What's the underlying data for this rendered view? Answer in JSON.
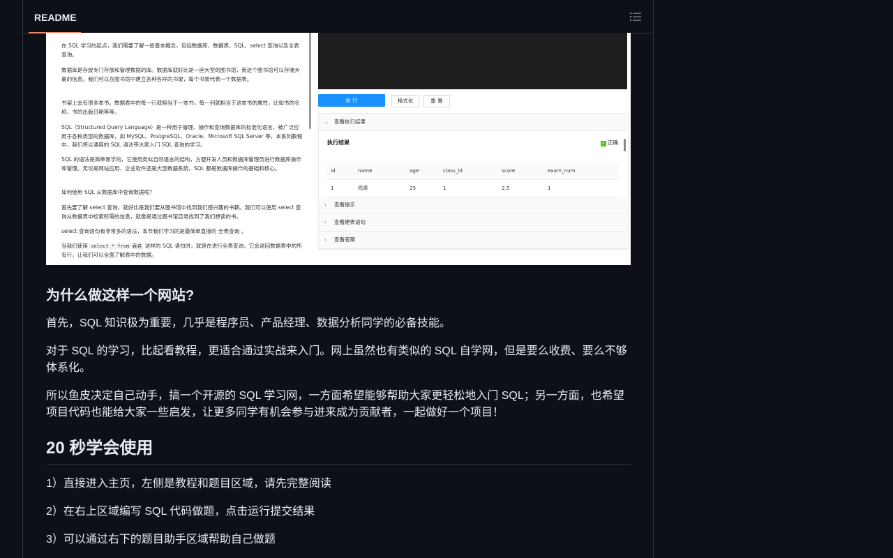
{
  "header": {
    "tab_label": "README",
    "outline_icon": "list-unordered-icon"
  },
  "screenshot": {
    "left_paragraphs": [
      "在 SQL 学习的起点，我们需要了解一些基本概念，包括数据库、数据表、SQL、select 查询以及全表查询。",
      "数据库是存放专门存放和管理数据的库。数据库就好比是一座大型的图书馆，而这个图书馆可以存储大量的信息。我们可以在图书馆中建立各种各样的书架，每个书架代表一个数据表。",
      "书架上会有很多本书，数据表中的每一行就相当于一本书，每一列就相当于这本书的属性，比如书的名称、书的出版日期等等。",
      "SQL（Structured Query Language）是一种用于管理、操作和查询数据库的标准化语言，被广泛应用于各种类型的数据库，如 MySQL、PostgreSQL、Oracle、Microsoft SQL Server 等，本系列教程中，我们将以通用的 SQL 语法带大家入门 SQL 查询的学习。",
      "SQL 的语法是简单易学的，它使用类似自然语言的结构，方便开发人员和数据库管理员进行数据库操作和管理。无论是网站应用、企业软件还是大型数据系统，SQL 都是数据库操作的基础和核心。",
      "如何使用 SQL 从数据库中查询数据呢？",
      "首先要了解 select 查询，就好比是我们要从图书馆中找到我们感兴趣的书籍。我们可以使用 select 查询从数据表中检索所需的信息，就像是通过图书馆目录找到了我们想读的书。",
      "select 查询语句有非常多的语法，本节我们学习的是最简单直接的 全表查询 。"
    ],
    "last_paragraph": {
      "before": "当我们使用 ",
      "code": "select * from 表名",
      "after": " 这样的 SQL 语句时，就是在进行全表查询，它会返回数据表中的所有行，让我们可以全面了解表中的数据。"
    },
    "buttons": {
      "run": "运 行",
      "format": "格式化",
      "reset": "重 置"
    },
    "collapse": {
      "result_header": "查看执行结果",
      "hint_header": "查看提示",
      "ddl_header": "查看建表语句",
      "answer_header": "查看答案"
    },
    "result": {
      "title": "执行结果",
      "status": "正确",
      "columns": [
        "id",
        "name",
        "age",
        "class_id",
        "score",
        "exam_num"
      ],
      "rows": [
        [
          "1",
          "鸡哥",
          "25",
          "1",
          "2.5",
          "1"
        ]
      ]
    }
  },
  "section_why": {
    "heading": "为什么做这样一个网站?",
    "paragraphs": [
      "首先，SQL 知识极为重要，几乎是程序员、产品经理、数据分析同学的必备技能。",
      "对于 SQL 的学习，比起看教程，更适合通过实战来入门。网上虽然也有类似的 SQL 自学网，但是要么收费、要么不够体系化。",
      "所以鱼皮决定自己动手，搞一个开源的 SQL 学习网，一方面希望能够帮助大家更轻松地入门 SQL；另一方面，也希望项目代码也能给大家一些启发，让更多同学有机会参与进来成为贡献者，一起做好一个项目！"
    ]
  },
  "section_usage": {
    "heading": "20 秒学会使用",
    "steps": [
      "1）直接进入主页，左侧是教程和题目区域，请先完整阅读",
      "2）在右上区域编写 SQL 代码做题，点击运行提交结果",
      "3）可以通过右下的题目助手区域帮助自己做题"
    ]
  }
}
